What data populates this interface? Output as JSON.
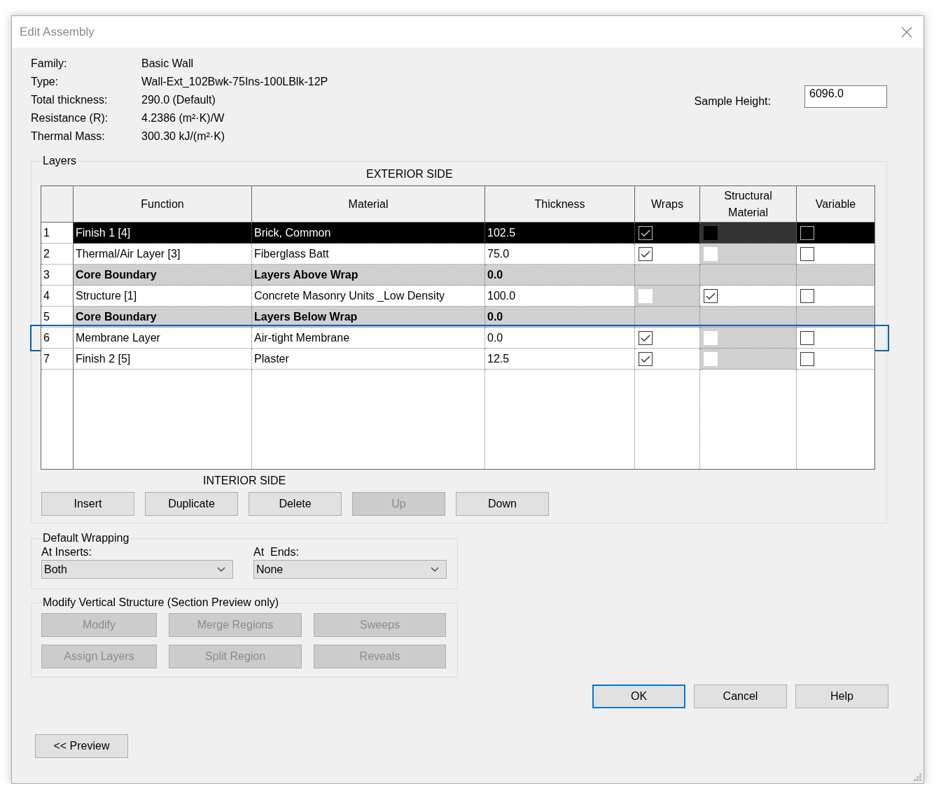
{
  "window": {
    "title": "Edit Assembly"
  },
  "properties": [
    {
      "label": "Family:",
      "value": "Basic Wall"
    },
    {
      "label": "Type:",
      "value": "Wall-Ext_102Bwk-75Ins-100LBlk-12P"
    },
    {
      "label": "Total thickness:",
      "value": "290.0 (Default)"
    },
    {
      "label": "Resistance (R):",
      "value": "4.2386 (m²·K)/W"
    },
    {
      "label": "Thermal Mass:",
      "value": "300.30 kJ/(m²·K)"
    }
  ],
  "sample_height": {
    "label": "Sample Height:",
    "value": "6096.0"
  },
  "layers": {
    "legend": "Layers",
    "exterior_label": "EXTERIOR SIDE",
    "interior_label": "INTERIOR SIDE",
    "columns": [
      "Function",
      "Material",
      "Thickness",
      "Wraps",
      "Structural Material",
      "Variable"
    ],
    "rows": [
      {
        "number": "1",
        "function": "Finish 1 [4]",
        "material": "Brick, Common",
        "thickness": "102.5",
        "kind": "layer",
        "selected": true,
        "focused": false,
        "wraps": {
          "checked": true,
          "disabled": false
        },
        "structural": {
          "checked": false,
          "disabled": true
        },
        "variable": {
          "checked": false,
          "disabled": false
        }
      },
      {
        "number": "2",
        "function": "Thermal/Air Layer [3]",
        "material": "Fiberglass Batt",
        "thickness": "75.0",
        "kind": "layer",
        "selected": false,
        "focused": false,
        "wraps": {
          "checked": true,
          "disabled": false
        },
        "structural": {
          "checked": false,
          "disabled": true
        },
        "variable": {
          "checked": false,
          "disabled": false
        }
      },
      {
        "number": "3",
        "function": "Core Boundary",
        "material": "Layers Above Wrap",
        "thickness": "0.0",
        "kind": "boundary",
        "selected": false,
        "focused": false
      },
      {
        "number": "4",
        "function": "Structure [1]",
        "material": "Concrete Masonry Units _Low Density",
        "thickness": "100.0",
        "kind": "layer",
        "selected": false,
        "focused": false,
        "wraps": {
          "checked": false,
          "disabled": true
        },
        "structural": {
          "checked": true,
          "disabled": false
        },
        "variable": {
          "checked": false,
          "disabled": false
        }
      },
      {
        "number": "5",
        "function": "Core Boundary",
        "material": "Layers Below Wrap",
        "thickness": "0.0",
        "kind": "boundary",
        "selected": false,
        "focused": false
      },
      {
        "number": "6",
        "function": "Membrane Layer",
        "material": "Air-tight Membrane",
        "thickness": "0.0",
        "kind": "layer",
        "selected": false,
        "focused": true,
        "wraps": {
          "checked": true,
          "disabled": false
        },
        "structural": {
          "checked": false,
          "disabled": true
        },
        "variable": {
          "checked": false,
          "disabled": false
        }
      },
      {
        "number": "7",
        "function": "Finish 2 [5]",
        "material": "Plaster",
        "thickness": "12.5",
        "kind": "layer",
        "selected": false,
        "focused": false,
        "wraps": {
          "checked": true,
          "disabled": false
        },
        "structural": {
          "checked": false,
          "disabled": true
        },
        "variable": {
          "checked": false,
          "disabled": false
        }
      }
    ],
    "buttons": [
      {
        "label": "Insert",
        "disabled": false
      },
      {
        "label": "Duplicate",
        "disabled": false
      },
      {
        "label": "Delete",
        "disabled": false
      },
      {
        "label": "Up",
        "disabled": true
      },
      {
        "label": "Down",
        "disabled": false
      }
    ]
  },
  "default_wrapping": {
    "legend": "Default Wrapping",
    "fields": [
      {
        "label": "At Inserts:",
        "value": "Both"
      },
      {
        "label": "At  Ends:",
        "value": "None"
      }
    ]
  },
  "vertical_structure": {
    "legend": "Modify Vertical Structure (Section Preview only)",
    "buttons": [
      {
        "label": "Modify",
        "disabled": true
      },
      {
        "label": "Merge Regions",
        "disabled": true
      },
      {
        "label": "Sweeps",
        "disabled": true
      },
      {
        "label": "Assign Layers",
        "disabled": true
      },
      {
        "label": "Split Region",
        "disabled": true
      },
      {
        "label": "Reveals",
        "disabled": true
      }
    ]
  },
  "dialog_buttons": [
    {
      "label": "OK",
      "default": true
    },
    {
      "label": "Cancel",
      "default": false
    },
    {
      "label": "Help",
      "default": false
    }
  ],
  "preview_button": {
    "label": "<< Preview"
  }
}
